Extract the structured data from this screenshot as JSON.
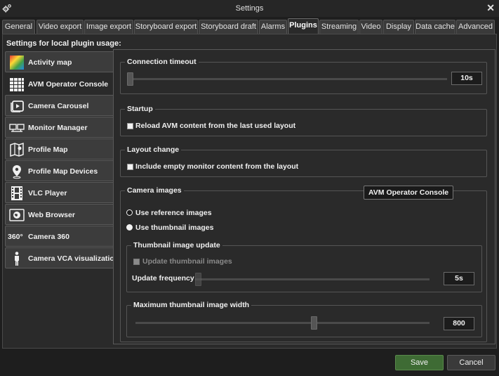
{
  "window": {
    "title": "Settings",
    "close_glyph": "✕",
    "icon": "gear-icon"
  },
  "tabs": [
    {
      "label": "General"
    },
    {
      "label": "Video export"
    },
    {
      "label": "Image export"
    },
    {
      "label": "Storyboard export"
    },
    {
      "label": "Storyboard draft"
    },
    {
      "label": "Alarms"
    },
    {
      "label": "Plugins",
      "active": true
    },
    {
      "label": "Streaming"
    },
    {
      "label": "Video"
    },
    {
      "label": "Display"
    },
    {
      "label": "Data cache"
    },
    {
      "label": "Advanced"
    }
  ],
  "plugins_header": "Settings for local plugin usage:",
  "plugins": [
    {
      "label": "Activity map",
      "icon": "heatmap-icon"
    },
    {
      "label": "AVM Operator Console",
      "icon": "grid-icon",
      "active": true
    },
    {
      "label": "Camera Carousel",
      "icon": "carousel-icon"
    },
    {
      "label": "Monitor Manager",
      "icon": "monitors-icon"
    },
    {
      "label": "Profile Map",
      "icon": "map-icon"
    },
    {
      "label": "Profile Map Devices",
      "icon": "map-pin-icon"
    },
    {
      "label": "VLC Player",
      "icon": "film-icon"
    },
    {
      "label": "Web Browser",
      "icon": "globe-icon"
    },
    {
      "label": "Camera 360",
      "icon": "camera-360-icon",
      "icon_text": "360°"
    },
    {
      "label": "Camera VCA visualization",
      "icon": "person-icon"
    }
  ],
  "connection_timeout": {
    "title": "Connection timeout",
    "value": "10s"
  },
  "startup": {
    "title": "Startup",
    "reload_label": "Reload AVM content from the last used layout",
    "reload_checked": false
  },
  "layout_change": {
    "title": "Layout change",
    "include_empty_label": "Include empty monitor content from the layout",
    "include_empty_checked": false
  },
  "camera_images": {
    "title": "Camera images",
    "options": [
      {
        "label": "Use reference images",
        "selected": false
      },
      {
        "label": "Use thumbnail images",
        "selected": true
      }
    ],
    "thumbnail_update": {
      "title": "Thumbnail image update",
      "update_label": "Update thumbnail images",
      "update_checked": false,
      "update_enabled": false,
      "frequency_label": "Update frequency",
      "frequency_value": "5s"
    },
    "max_width": {
      "title": "Maximum thumbnail image width",
      "value": "800"
    }
  },
  "tooltip": "AVM Operator Console",
  "buttons": {
    "save": "Save",
    "cancel": "Cancel"
  },
  "colors": {
    "save_bg": "#3e6b34",
    "background": "#2a2a2a",
    "active_tab": "#2a2a2a"
  }
}
